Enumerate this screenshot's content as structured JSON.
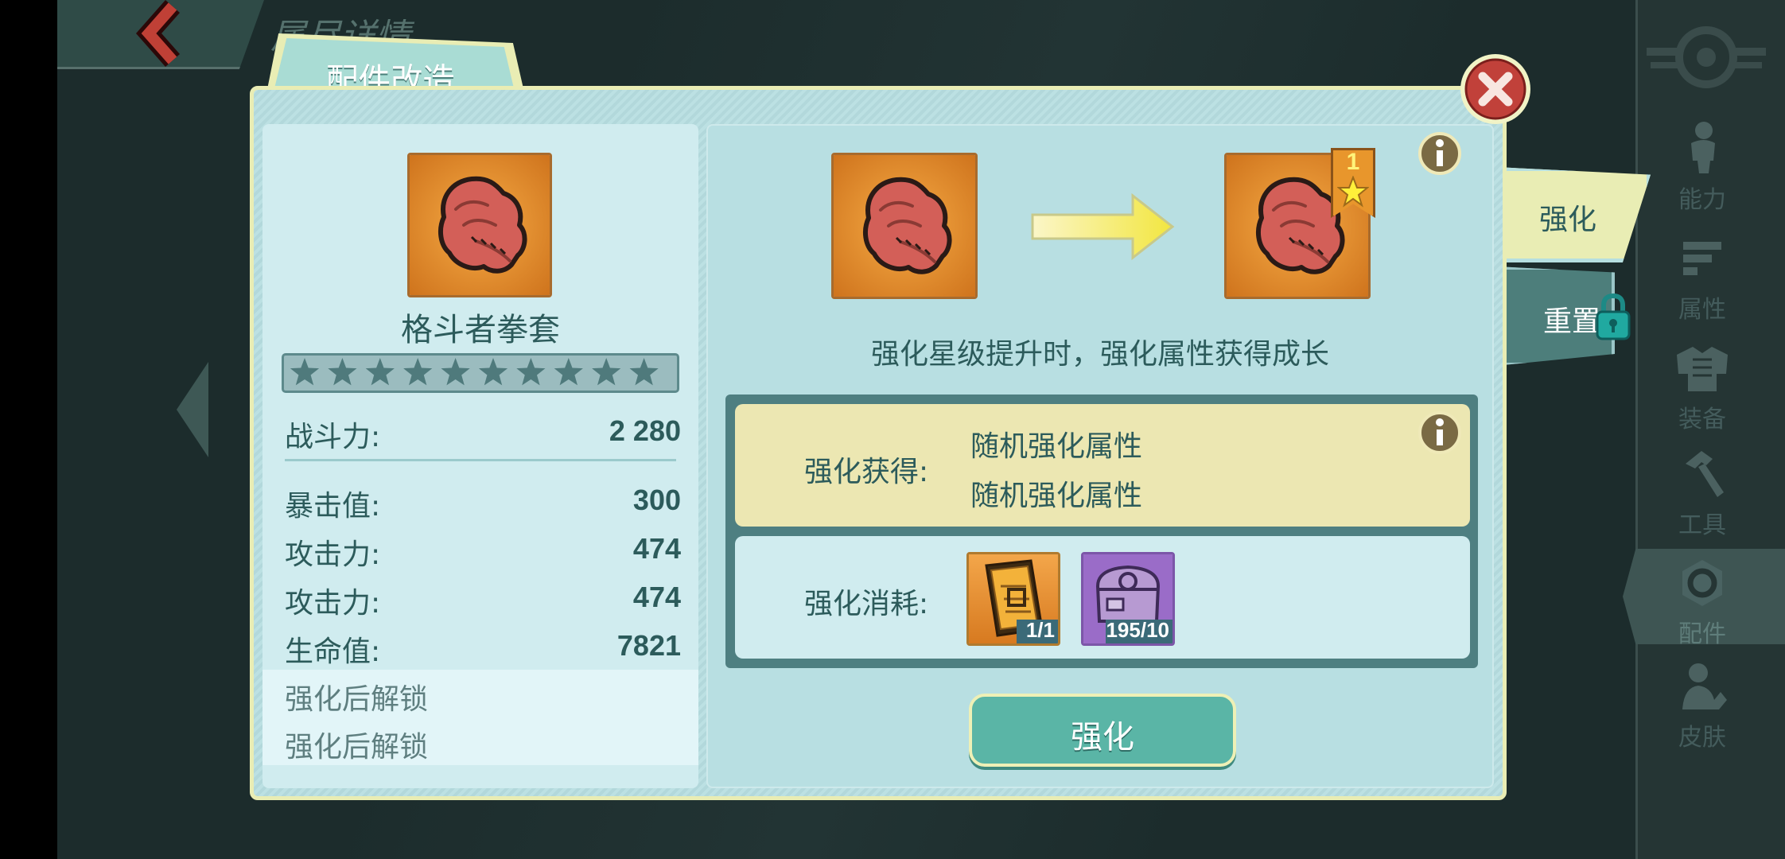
{
  "header": {
    "back_icon": "back-chevron-icon",
    "title": "属尽详情"
  },
  "modal": {
    "title_tab": "配件改造",
    "close_icon": "close-x-icon",
    "item": {
      "name": "格斗者拳套",
      "icon": "boxing-glove-icon",
      "stars_total": 10,
      "stars_filled": 0,
      "power_label": "战斗力:",
      "power_value": "2 280",
      "stats": [
        {
          "label": "暴击值:",
          "value": "300"
        },
        {
          "label": "攻击力:",
          "value": "474"
        },
        {
          "label": "攻击力:",
          "value": "474"
        },
        {
          "label": "生命值:",
          "value": "7821"
        }
      ],
      "locked_lines": [
        "强化后解锁",
        "强化后解锁"
      ]
    },
    "upgrade": {
      "target_star_level": "1",
      "description": "强化星级提升时，强化属性获得成长",
      "gain_label": "强化获得:",
      "gain_items": [
        "随机强化属性",
        "随机强化属性"
      ],
      "cost_label": "强化消耗:",
      "costs": [
        {
          "name": "enhance-card",
          "icon": "enhance-card-icon",
          "count": "1/1"
        },
        {
          "name": "part-crate",
          "icon": "gear-crate-icon",
          "count": "195/10"
        }
      ],
      "action_button": "强化"
    },
    "side_tabs": [
      {
        "label": "强化",
        "active": true
      },
      {
        "label": "重置",
        "locked": true
      }
    ]
  },
  "right_nav": [
    {
      "label": "能力",
      "icon": "person-icon"
    },
    {
      "label": "属性",
      "icon": "attribute-bars-icon"
    },
    {
      "label": "装备",
      "icon": "armor-icon"
    },
    {
      "label": "工具",
      "icon": "hammer-icon"
    },
    {
      "label": "配件",
      "icon": "gear-part-icon",
      "active": true
    },
    {
      "label": "皮肤",
      "icon": "skin-person-icon"
    }
  ],
  "colors": {
    "panel_bg": "#b8dfe2",
    "inner_bg": "#d0ecef",
    "accent_teal": "#5ab5a6",
    "text_teal": "#2c5b5b",
    "gain_bg": "#ece7b2",
    "item_orange": "#e08a2b"
  }
}
